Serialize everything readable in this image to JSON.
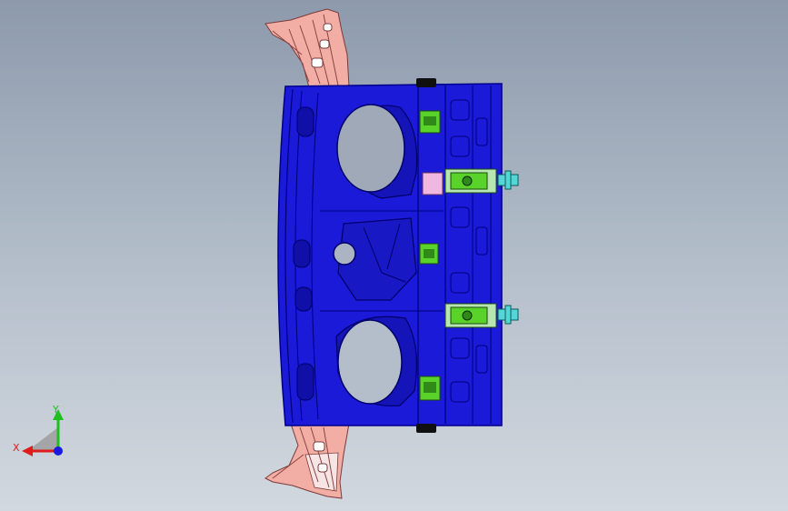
{
  "viewport": {
    "background_top": "#8d9aac",
    "background_bottom": "#d2d8df"
  },
  "model": {
    "panel_color": "#1a1ad8",
    "panel_edge_color": "#00008a",
    "bracket_color": "#f2aea4",
    "bracket_light_color": "#f7e4e4",
    "clamp_color": "#59d32a",
    "clamp_pale_color": "#b8e6b0",
    "pin_color": "#55d6d6",
    "pink_pad_color": "#f0b8e0"
  },
  "triad": {
    "x_label": "X",
    "y_label": "Y",
    "x_color": "#e01b1b",
    "y_color": "#1fbf1f",
    "z_color": "#1b1be0"
  }
}
